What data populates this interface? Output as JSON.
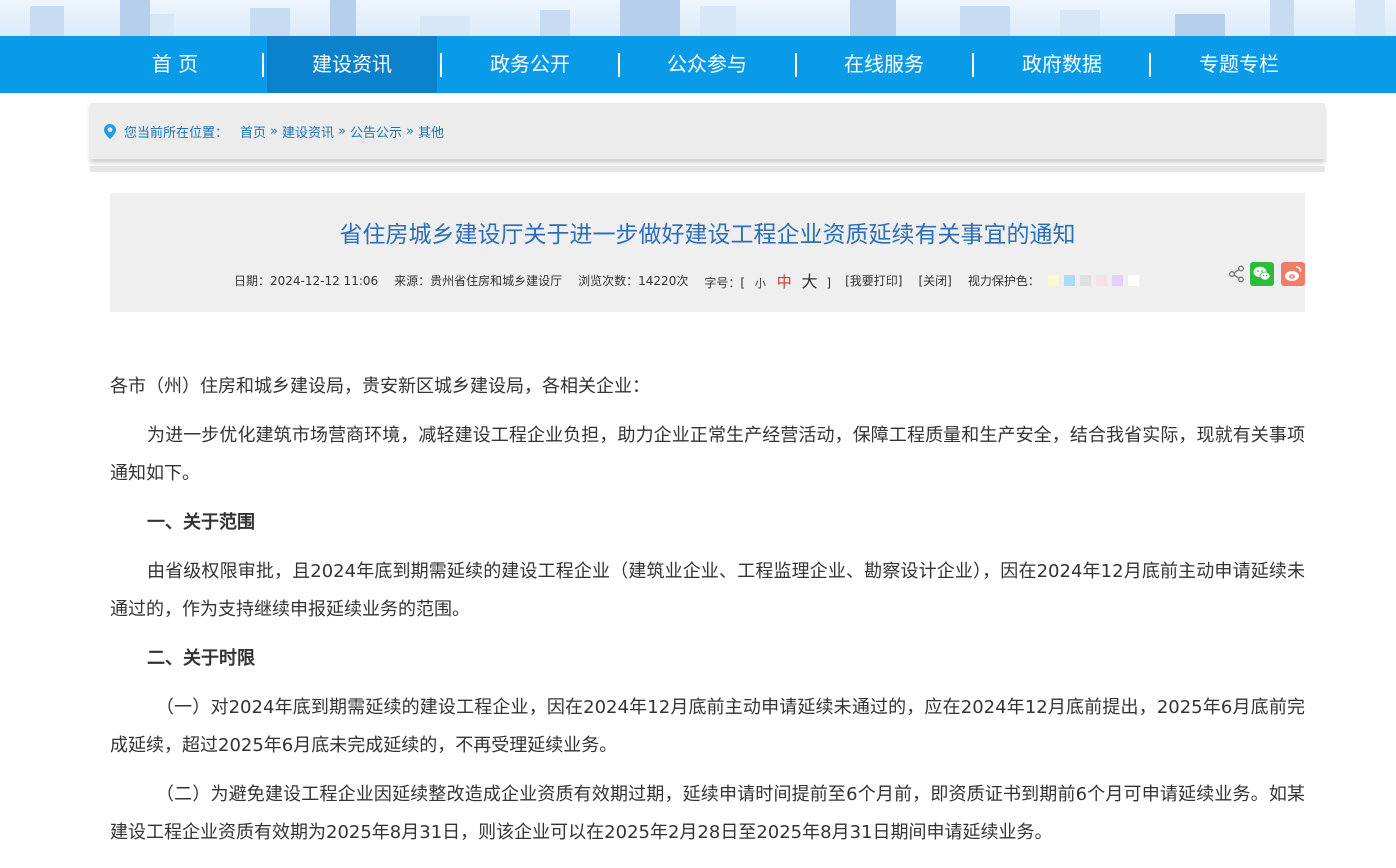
{
  "nav": {
    "items": [
      "首 页",
      "建设资讯",
      "政务公开",
      "公众参与",
      "在线服务",
      "政府数据",
      "专题专栏"
    ],
    "active": 1
  },
  "breadcrumb": {
    "label": "您当前所在位置：",
    "items": [
      "首页",
      "建设资讯",
      "公告公示",
      "其他"
    ],
    "separator": "»"
  },
  "article": {
    "title": "省住房城乡建设厅关于进一步做好建设工程企业资质延续有关事宜的通知",
    "date_label": "日期：2024-12-12 11:06",
    "source_label": "来源：贵州省住房和城乡建设厅",
    "views_label": "浏览次数：14220次",
    "font_size": {
      "label": "字号：",
      "open": "[",
      "small": "小",
      "medium": "中",
      "large": "大",
      "close": "]"
    },
    "print": "[我要打印]",
    "close": "[关闭]",
    "eye_care_label": "视力保护色：",
    "eye_care_colors": [
      "#fafad2",
      "#a9dcf5",
      "#e0e0e0",
      "#f5e1ea",
      "#e2d1f5",
      "#ffffff"
    ],
    "paragraphs": [
      "各市（州）住房和城乡建设局，贵安新区城乡建设局，各相关企业：",
      "为进一步优化建筑市场营商环境，减轻建设工程企业负担，助力企业正常生产经营活动，保障工程质量和生产安全，结合我省实际，现就有关事项通知如下。",
      "一、关于范围",
      "由省级权限审批，且2024年底到期需延续的建设工程企业（建筑业企业、工程监理企业、勘察设计企业），因在2024年12月底前主动申请延续未通过的，作为支持继续申报延续业务的范围。",
      "二、关于时限",
      "（一）对2024年底到期需延续的建设工程企业，因在2024年12月底前主动申请延续未通过的，应在2024年12月底前提出，2025年6月底前完成延续，超过2025年6月底未完成延续的，不再受理延续业务。",
      "（二）为避免建设工程企业因延续整改造成企业资质有效期过期，延续申请时间提前至6个月前，即资质证书到期前6个月可申请延续业务。如某建设工程企业资质有效期为2025年8月31日，则该企业可以在2025年2月28日至2025年8月31日期间申请延续业务。"
    ]
  }
}
